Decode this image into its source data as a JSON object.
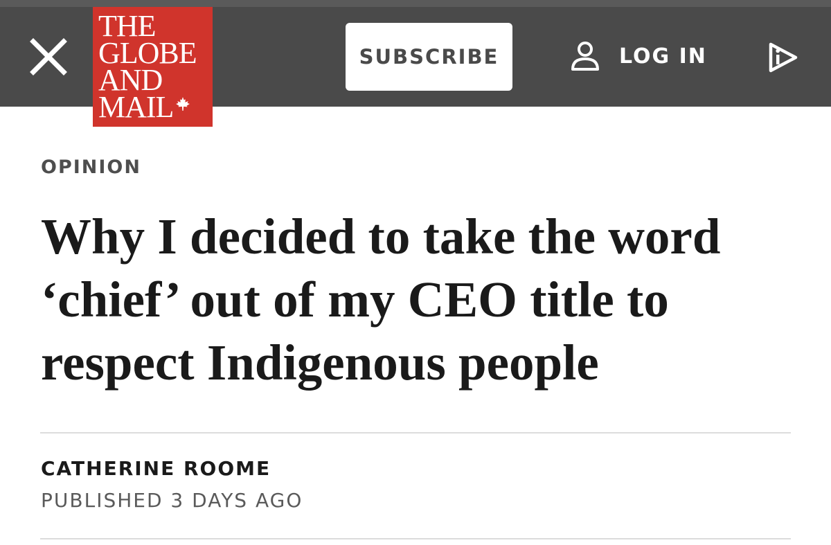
{
  "header": {
    "logo_lines": [
      "THE",
      "GLOBE",
      "AND",
      "MAIL"
    ],
    "subscribe_label": "SUBSCRIBE",
    "login_label": "LOG IN",
    "icons": {
      "close": "close-icon",
      "user": "user-icon",
      "logo_leaf": "maple-leaf-icon",
      "promo": "play-info-icon"
    },
    "colors": {
      "bar": "#4a4a4a",
      "logo_bg": "#d0342c"
    }
  },
  "article": {
    "section": "OPINION",
    "headline": "Why I decided to take the word ‘chief’ out of my CEO title to respect Indigenous people",
    "author": "CATHERINE ROOME",
    "published": "PUBLISHED 3 DAYS AGO"
  }
}
